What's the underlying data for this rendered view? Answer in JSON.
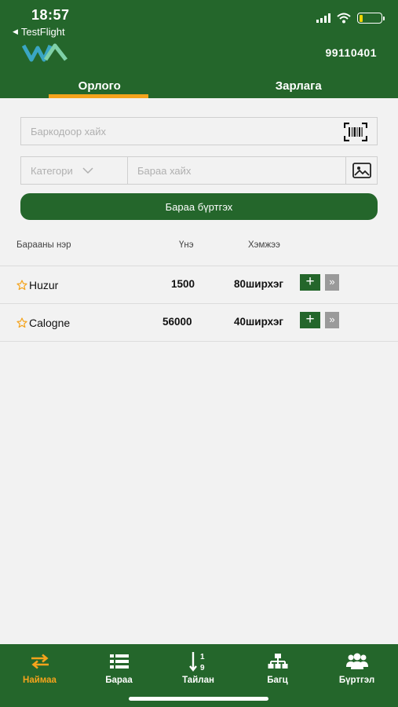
{
  "status_bar": {
    "time": "18:57",
    "back_app": "TestFlight",
    "battery_level": 0.18,
    "battery_color": "#f0d400"
  },
  "header": {
    "logo_icon": "company-logo",
    "phone": "99110401"
  },
  "tabs": [
    {
      "label": "Орлого",
      "active": true
    },
    {
      "label": "Зарлага",
      "active": false
    }
  ],
  "barcode_search": {
    "value": "",
    "placeholder": "Баркодоор хайх",
    "icon": "barcode-scan-icon"
  },
  "category_select": {
    "selected": "Категори",
    "icon": "chevron-down-icon"
  },
  "product_search": {
    "value": "",
    "placeholder": "Бараа хайх",
    "icon": "image-search-icon"
  },
  "register_button": {
    "label": "Бараа бүртгэх"
  },
  "table": {
    "headers": {
      "name": "Барааны нэр",
      "price": "Үнэ",
      "size": "Хэмжээ"
    },
    "rows": [
      {
        "name": "Huzur",
        "price": "1500",
        "size": "80ширхэг"
      },
      {
        "name": "Calogne",
        "price": "56000",
        "size": "40ширхэг"
      }
    ]
  },
  "bottom_nav": [
    {
      "label": "Наймаа",
      "icon": "swap-arrows-icon",
      "active": true
    },
    {
      "label": "Бараа",
      "icon": "list-icon",
      "active": false
    },
    {
      "label": "Тайлан",
      "icon": "sort-numeric-icon",
      "active": false
    },
    {
      "label": "Багц",
      "icon": "hierarchy-icon",
      "active": false
    },
    {
      "label": "Бүртгэл",
      "icon": "users-icon",
      "active": false
    }
  ],
  "colors": {
    "primary": "#24662b",
    "accent": "#f4a31c",
    "background": "#f2f2f2",
    "secondary_button": "#9a9a9a"
  }
}
